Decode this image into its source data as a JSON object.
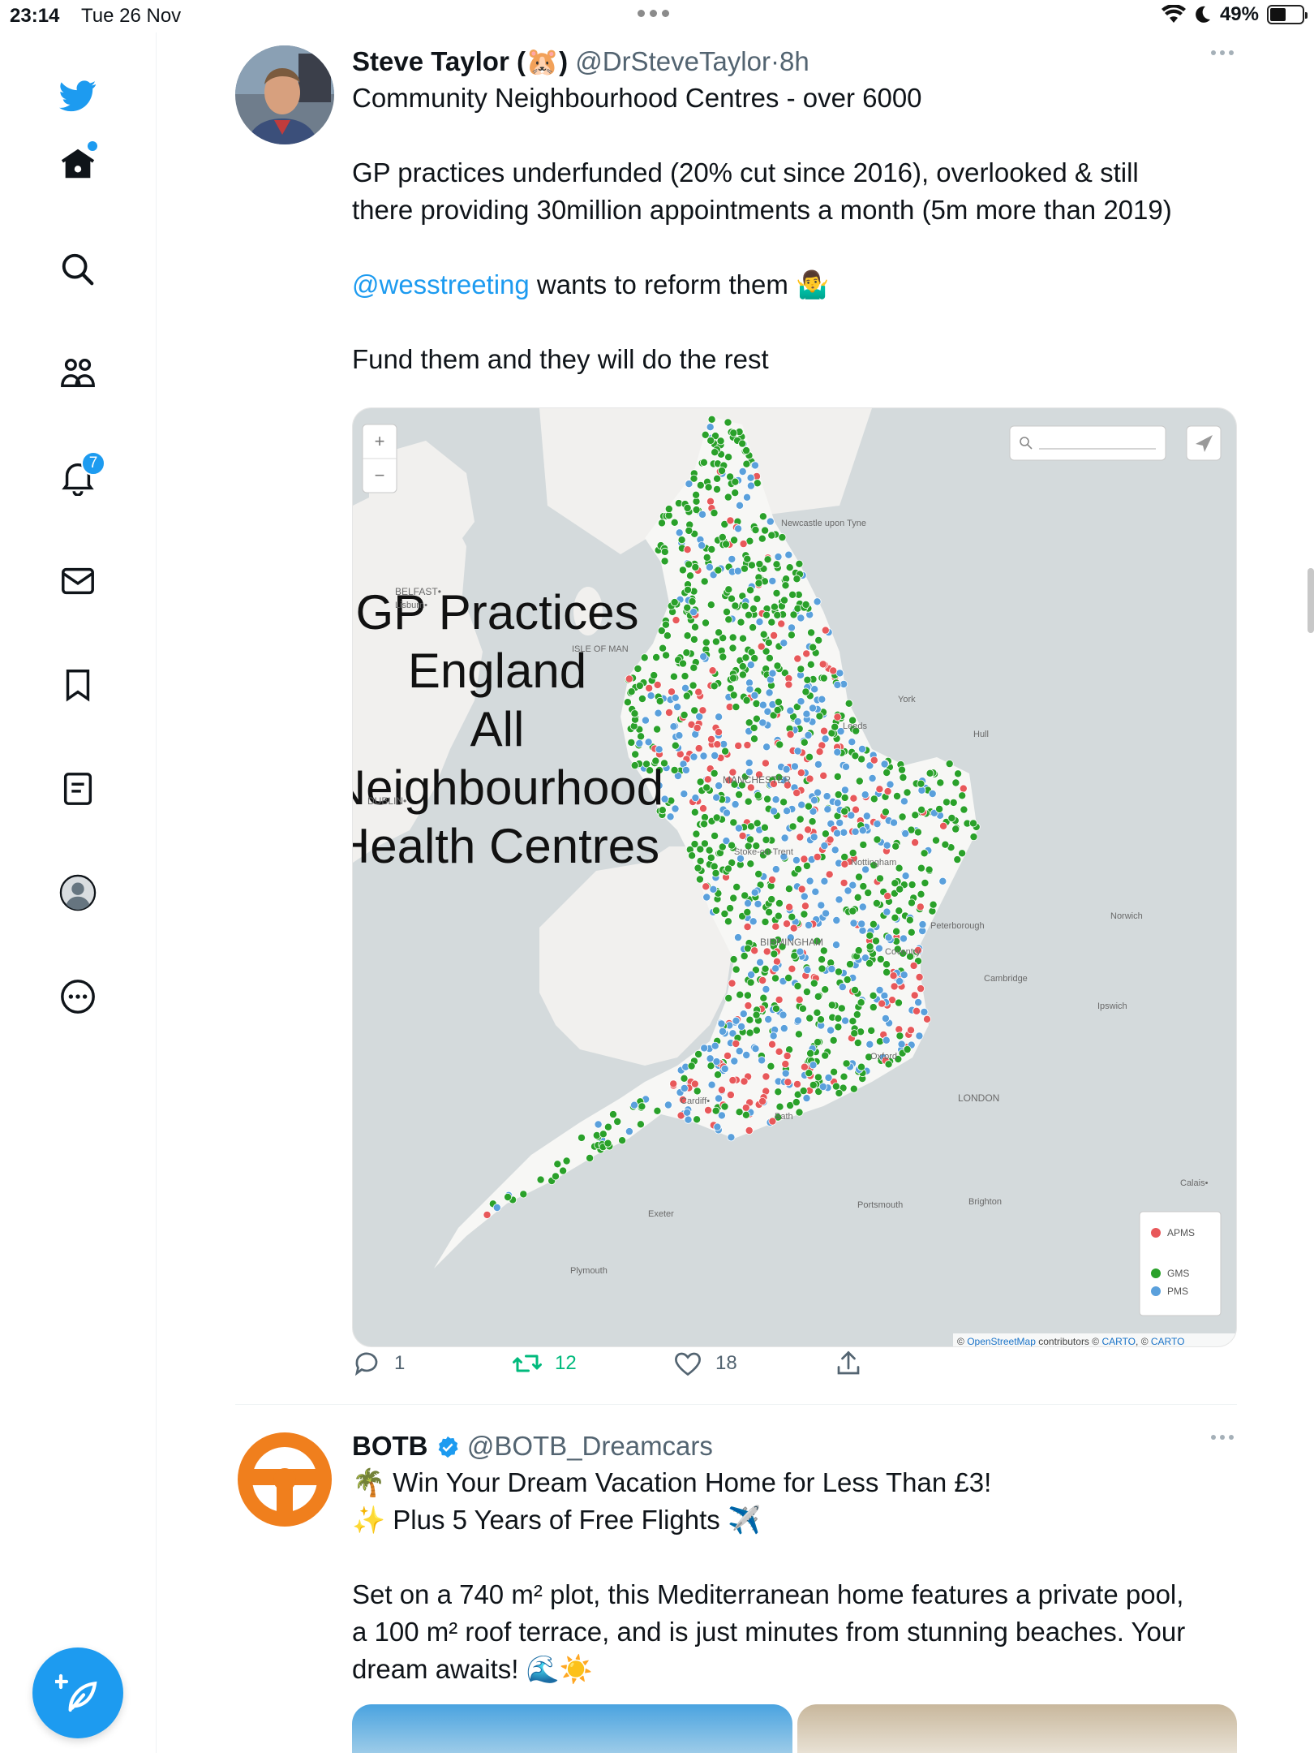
{
  "status_bar": {
    "time": "23:14",
    "date": "Tue 26 Nov",
    "battery": "49%",
    "battery_level": 0.49
  },
  "sidebar": {
    "notifications_count": "7"
  },
  "tweet1": {
    "name": "Steve Taylor (",
    "name_emoji": "🐹",
    "name_close": ")",
    "handle": "@DrSteveTaylor",
    "separator": "·",
    "time": "8h",
    "line1": "Community Neighbourhood Centres - over 6000",
    "line2": "GP practices underfunded (20% cut since 2016), overlooked & still",
    "line3": "there providing 30million appointments a month (5m more than 2019)",
    "mention": "@wesstreeting",
    "line4_rest": " wants to reform them 🤷‍♂️",
    "line5": "Fund them and they will do the rest",
    "map": {
      "title_lines": [
        "GP Practices",
        "England",
        "All",
        "Neighbourhood",
        "Health Centres"
      ],
      "place_labels": {
        "belfast": "BELFAST•",
        "lisburn": "Lisburn•",
        "dublin": "DUBLIN•",
        "isle_of_man": "ISLE OF MAN",
        "newcastle": "Newcastle upon Tyne",
        "york": "York",
        "leeds": "Leeds",
        "hull": "Hull",
        "manchester": "MANCHESTER",
        "stoke": "Stoke-on-Trent",
        "nottingham": "Nottingham",
        "norwich": "Norwich",
        "peterborough": "Peterborough",
        "birmingham": "BIRMINGHAM",
        "coventry": "Coventry",
        "cambridge": "Cambridge",
        "ipswich": "Ipswich",
        "oxford": "Oxford",
        "london": "LONDON",
        "cardiff": "Cardiff•",
        "bath": "Bath",
        "calais": "Calais•",
        "exeter": "Exeter",
        "portsmouth": "Portsmouth",
        "brighton": "Brighton",
        "plymouth": "Plymouth"
      },
      "zoom_in": "+",
      "zoom_out": "−",
      "legend": [
        {
          "label": "APMS",
          "color": "#e8585a"
        },
        {
          "label": "GMS",
          "color": "#2aa12a"
        },
        {
          "label": "PMS",
          "color": "#5aa0dc"
        }
      ],
      "attribution_prefix": "© ",
      "attribution_osm": "OpenStreetMap",
      "attribution_mid": " contributors © ",
      "attribution_carto1": "CARTO",
      "attribution_sep": ", © ",
      "attribution_carto2": "CARTO"
    },
    "actions": {
      "replies": "1",
      "retweets": "12",
      "likes": "18"
    }
  },
  "tweet2": {
    "name": "BOTB",
    "handle": "@BOTB_Dreamcars",
    "line1": "🌴 Win Your Dream Vacation Home for Less Than £3!",
    "line2": "✨ Plus 5 Years of Free Flights ✈️",
    "line3": "Set on a 740 m² plot, this Mediterranean home features a private pool,",
    "line4": "a 100 m² roof terrace, and is just minutes from stunning beaches. Your",
    "line5": "dream awaits! 🌊☀️"
  }
}
